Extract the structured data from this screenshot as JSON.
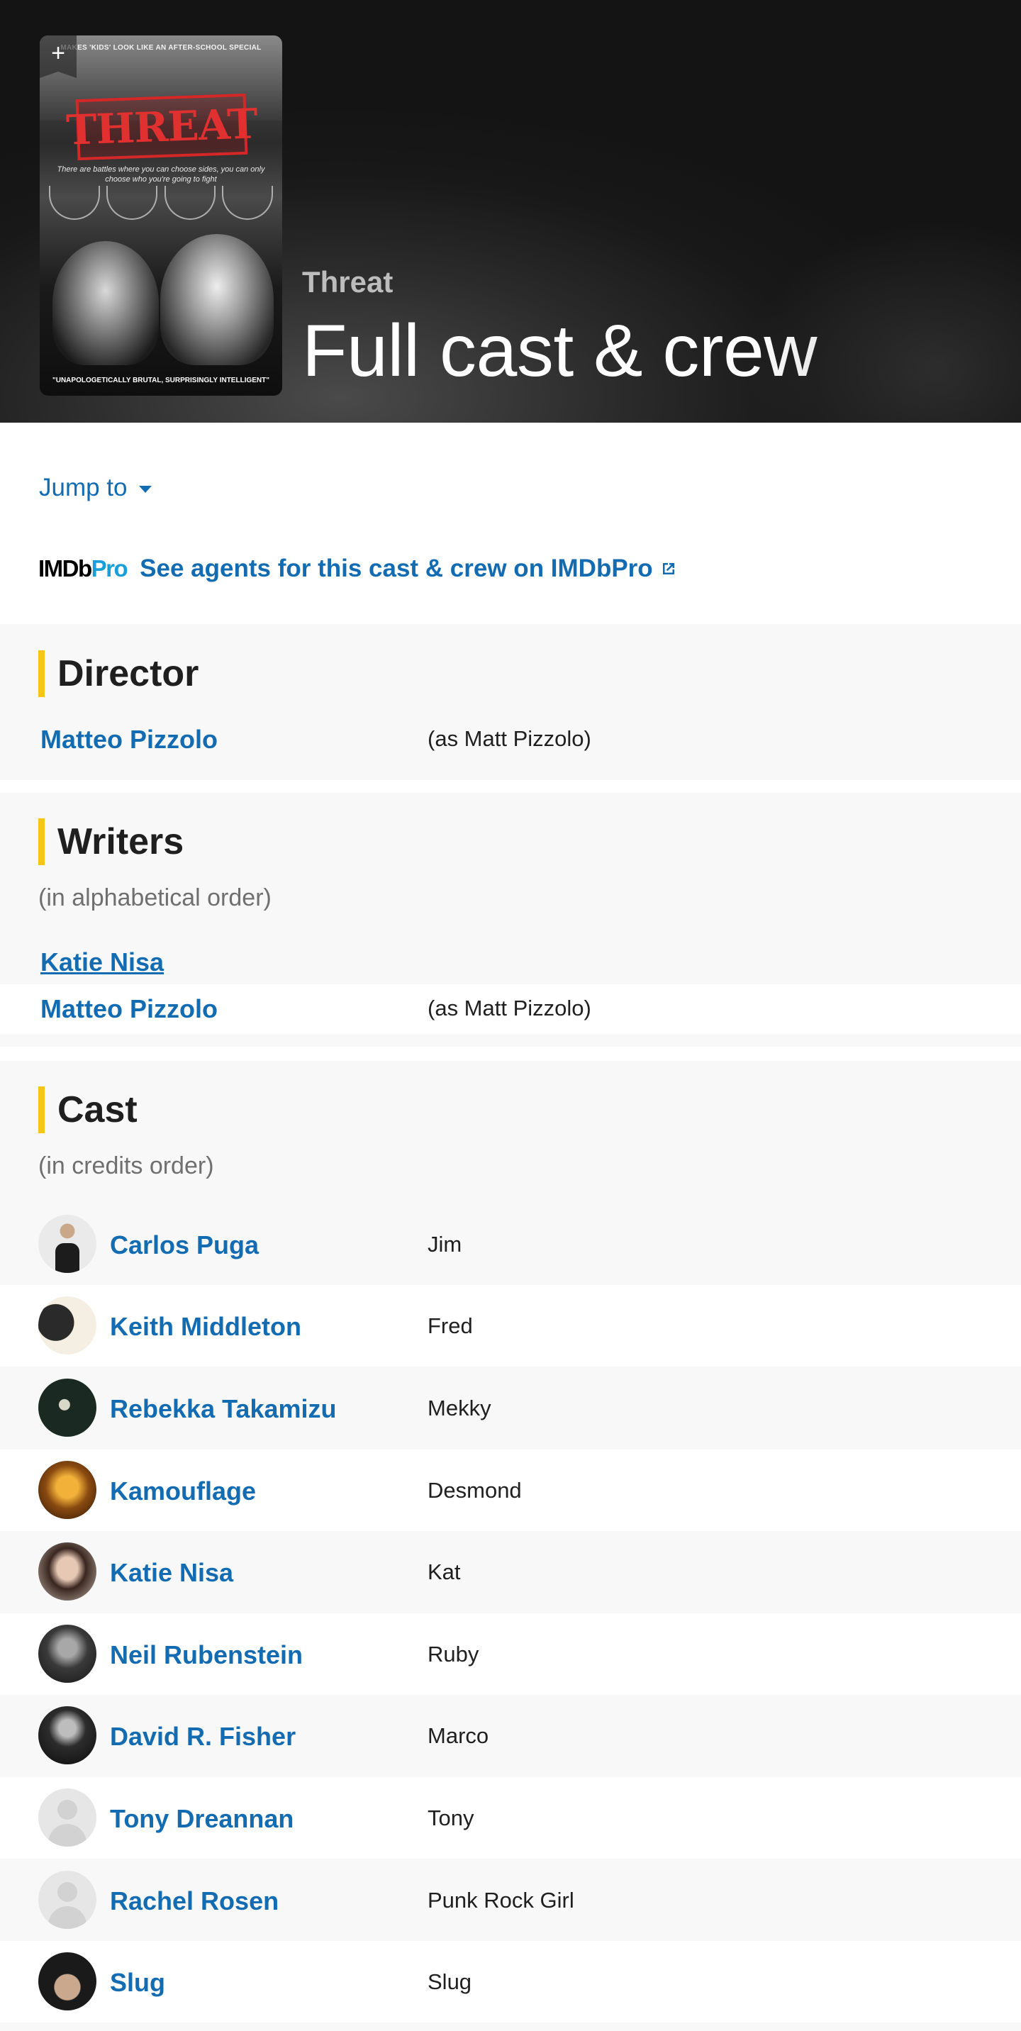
{
  "hero": {
    "subtitle": "Threat",
    "title": "Full cast & crew",
    "poster": {
      "tagline": "MAKES 'KIDS' LOOK LIKE AN AFTER-SCHOOL SPECIAL",
      "title": "THREAT",
      "subline": "There are battles where you can choose sides, you can only choose who you're going to fight",
      "quote": "\"UNAPOLOGETICALLY BRUTAL, SURPRISINGLY INTELLIGENT\"",
      "add_label": "+"
    }
  },
  "jump_to": {
    "label": "Jump to"
  },
  "imdbpro": {
    "logo_a": "IMDb",
    "logo_b": "Pro",
    "link": "See agents for this cast & crew on IMDbPro"
  },
  "director": {
    "title": "Director",
    "rows": [
      {
        "name": "Matteo Pizzolo",
        "role": "(as Matt Pizzolo)"
      }
    ]
  },
  "writers": {
    "title": "Writers",
    "note": "(in alphabetical order)",
    "rows": [
      {
        "name": "Katie Nisa",
        "role": ""
      },
      {
        "name": "Matteo Pizzolo",
        "role": "(as Matt Pizzolo)"
      }
    ]
  },
  "cast": {
    "title": "Cast",
    "note": "(in credits order)",
    "rows": [
      {
        "name": "Carlos Puga",
        "role": "Jim",
        "avatar": "photo-dark-suit"
      },
      {
        "name": "Keith Middleton",
        "role": "Fred",
        "avatar": "photo-dark"
      },
      {
        "name": "Rebekka Takamizu",
        "role": "Mekky",
        "avatar": "photo-dark-light"
      },
      {
        "name": "Kamouflage",
        "role": "Desmond",
        "avatar": "photo-orange"
      },
      {
        "name": "Katie Nisa",
        "role": "Kat",
        "avatar": "photo-portrait"
      },
      {
        "name": "Neil Rubenstein",
        "role": "Ruby",
        "avatar": "photo-bw"
      },
      {
        "name": "David R. Fisher",
        "role": "Marco",
        "avatar": "photo-bw-dark"
      },
      {
        "name": "Tony Dreannan",
        "role": "Tony",
        "avatar": "placeholder"
      },
      {
        "name": "Rachel Rosen",
        "role": "Punk Rock Girl",
        "avatar": "placeholder"
      },
      {
        "name": "Slug",
        "role": "Slug",
        "avatar": "photo-cap"
      }
    ]
  },
  "colors": {
    "link": "#136cb2",
    "accent": "#f5c518",
    "pro_blue": "#1a9ed8"
  }
}
